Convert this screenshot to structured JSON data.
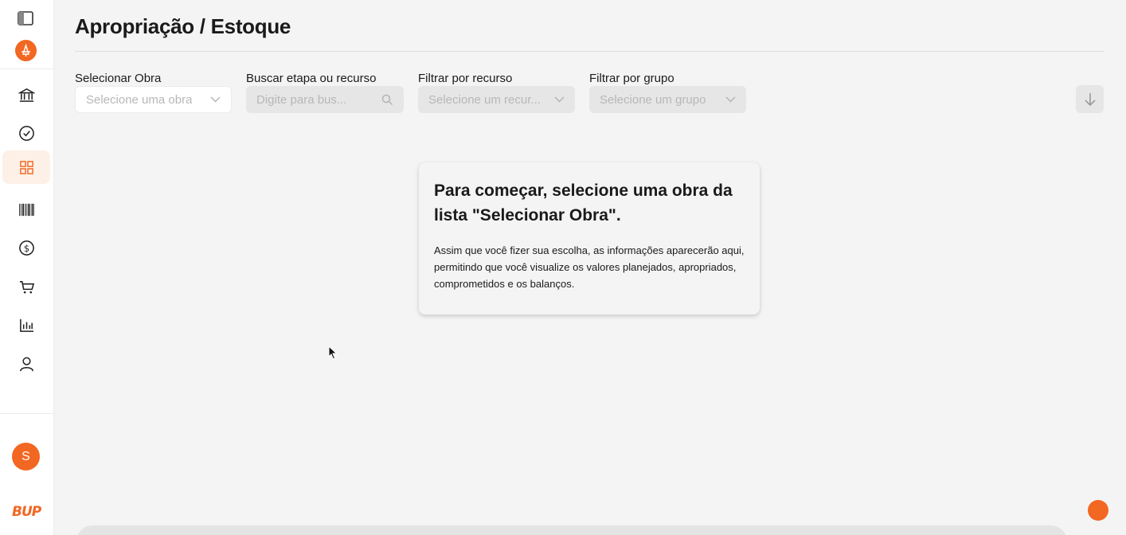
{
  "page": {
    "title": "Apropriação / Estoque"
  },
  "sidebar": {
    "avatar_letter": "S",
    "brand": "BUP",
    "accent": "#f26722",
    "items": [
      {
        "name": "bank-icon",
        "active": false
      },
      {
        "name": "check-circle-icon",
        "active": false
      },
      {
        "name": "grid-icon",
        "active": true
      },
      {
        "name": "barcode-icon",
        "active": false
      },
      {
        "name": "dollar-icon",
        "active": false
      },
      {
        "name": "cart-icon",
        "active": false
      },
      {
        "name": "bar-chart-icon",
        "active": false
      },
      {
        "name": "user-icon",
        "active": false
      }
    ]
  },
  "filters": {
    "obra": {
      "label": "Selecionar Obra",
      "placeholder": "Selecione uma obra"
    },
    "busca": {
      "label": "Buscar etapa ou recurso",
      "placeholder": "Digite para bus..."
    },
    "recurso": {
      "label": "Filtrar por recurso",
      "placeholder": "Selecione um recur..."
    },
    "grupo": {
      "label": "Filtrar por grupo",
      "placeholder": "Selecione um grupo"
    }
  },
  "empty_state": {
    "title": "Para começar, selecione uma obra da lista \"Selecionar Obra\".",
    "text": "Assim que você fizer sua escolha, as informações aparecerão aqui, permitindo que você visualize os valores planejados, apropriados, comprometidos e os balanços."
  }
}
